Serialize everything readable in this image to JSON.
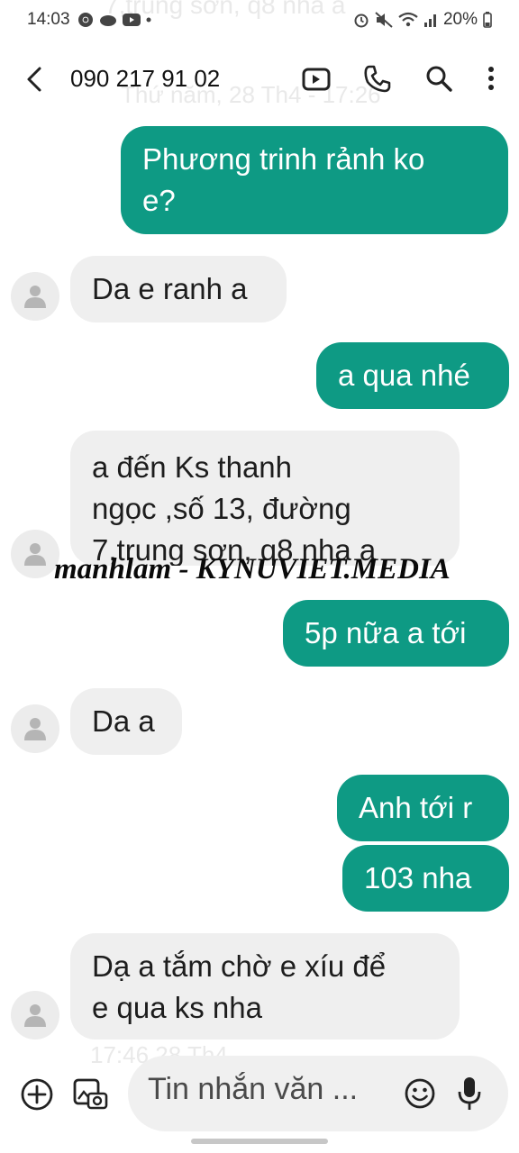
{
  "status_bar": {
    "time": "14:03",
    "battery": "20%"
  },
  "scroll_overlay": {
    "top_text": "7,trung sơn, q8  nha a",
    "date_header": "Thứ năm, 28 Th4 - 17:26",
    "bottom_time": "17:46 28 Th4"
  },
  "header": {
    "contact_number": "090 217 91 02"
  },
  "messages": [
    {
      "type": "outgoing",
      "lines": [
        "Phương trinh rảnh ko",
        "e?"
      ]
    },
    {
      "type": "incoming",
      "lines": [
        "Da e ranh a"
      ]
    },
    {
      "type": "outgoing",
      "lines": [
        "a qua nhé"
      ]
    },
    {
      "type": "incoming",
      "lines": [
        "a đến Ks thanh",
        "ngọc ,số 13, đường",
        "7,trung sơn, q8  nha a"
      ]
    },
    {
      "type": "outgoing",
      "lines": [
        "5p nữa a tới"
      ]
    },
    {
      "type": "incoming",
      "lines": [
        "Da a"
      ]
    },
    {
      "type": "outgoing",
      "lines": [
        "Anh tới r"
      ]
    },
    {
      "type": "outgoing",
      "lines": [
        "103 nha"
      ]
    },
    {
      "type": "incoming",
      "lines": [
        "Dạ a tắm chờ e xíu để",
        "e qua ks nha"
      ]
    }
  ],
  "watermark": "manhlam - KYNUVIET.MEDIA",
  "composer": {
    "placeholder": "Tin nhắn văn ..."
  },
  "icons": {
    "back": "back-arrow-icon",
    "video": "video-call-icon",
    "phone": "phone-icon",
    "search": "search-icon",
    "more": "more-vert-icon",
    "avatar": "person-icon",
    "add": "add-circle-icon",
    "gallery": "gallery-camera-icon",
    "emoji": "emoji-icon",
    "mic": "mic-icon"
  },
  "colors": {
    "outgoing_bubble": "#0e9a84",
    "incoming_bubble": "#efefef"
  }
}
